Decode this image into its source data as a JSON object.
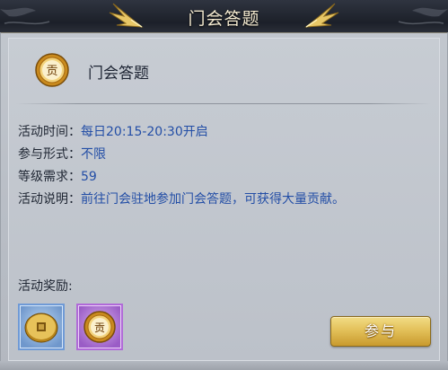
{
  "header": {
    "title": "门会答题"
  },
  "activity": {
    "name": "门会答题",
    "rows": [
      {
        "label": "活动时间：",
        "value": "每日20:15-20:30开启"
      },
      {
        "label": "参与形式：",
        "value": "不限"
      },
      {
        "label": "等级需求：",
        "value": "59"
      },
      {
        "label": "活动说明：",
        "value": "前往门会驻地参加门会答题，可获得大量贡献。"
      }
    ]
  },
  "rewards": {
    "label": "活动奖励:",
    "items": [
      {
        "icon": "gold-coin-icon",
        "rarity_color": "#6f9ad6"
      },
      {
        "icon": "contribution-coin-icon",
        "rarity_color": "#b06ad8",
        "glyph": "贡"
      }
    ]
  },
  "title_icon": {
    "glyph": "贡"
  },
  "actions": {
    "join_label": "参与"
  },
  "colors": {
    "value_text": "#234ea6",
    "button_gold": "#e3c15a",
    "header_bg": "#1c2029"
  }
}
